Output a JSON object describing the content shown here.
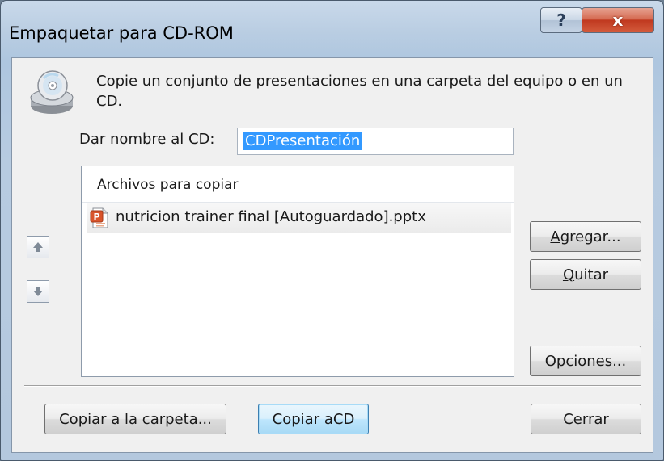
{
  "window": {
    "title": "Empaquetar para CD-ROM",
    "help_label": "?",
    "close_label": "x"
  },
  "instructions": "Copie un conjunto de presentaciones en una carpeta del equipo o en un CD.",
  "cd_name": {
    "label_accel": "D",
    "label_rest": "ar nombre al CD:",
    "value": "CDPresentación"
  },
  "files": {
    "header": "Archivos para copiar",
    "items": [
      {
        "name": "nutricion trainer final [Autoguardado].pptx",
        "icon": "pptx-file-icon"
      }
    ]
  },
  "buttons": {
    "add": {
      "accel": "A",
      "rest": "gregar..."
    },
    "remove": {
      "accel": "Q",
      "rest": "uitar"
    },
    "options": {
      "accel": "O",
      "rest": "pciones..."
    },
    "copy_folder": {
      "pre": "Co",
      "accel": "p",
      "rest": "iar a la carpeta..."
    },
    "copy_cd": {
      "pre": "Copiar a ",
      "accel": "C",
      "rest": "D"
    },
    "close": "Cerrar"
  },
  "colors": {
    "selection": "#3399ff",
    "close_button": "#c0391f",
    "default_button_border": "#3c7fb1"
  }
}
